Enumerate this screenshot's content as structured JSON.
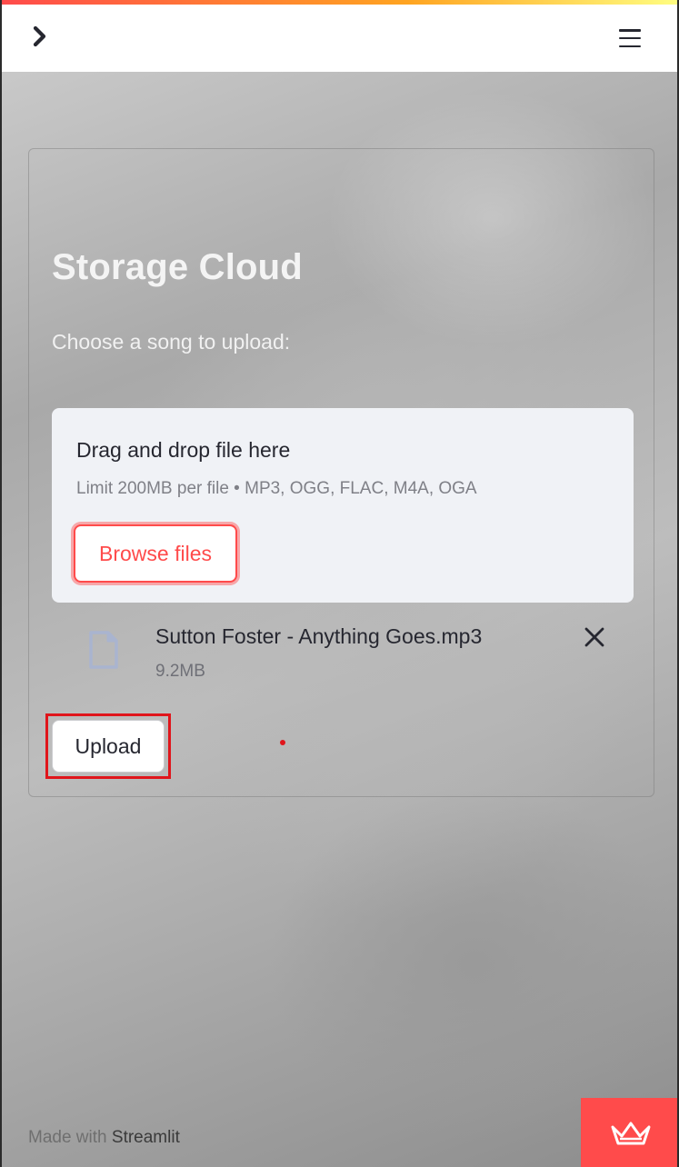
{
  "header": {
    "expand_icon": "chevron-right-icon",
    "menu_icon": "hamburger-menu-icon"
  },
  "main": {
    "title": "Storage Cloud",
    "uploader_label": "Choose a song to upload:",
    "dropzone": {
      "instruction": "Drag and drop file here",
      "limit_text": "Limit 200MB per file • MP3, OGG, FLAC, M4A, OGA",
      "browse_label": "Browse files"
    },
    "uploaded_file": {
      "icon": "file-icon",
      "name": "Sutton Foster - Anything Goes.mp3",
      "size": "9.2MB",
      "remove_icon": "close-icon"
    },
    "upload_label": "Upload"
  },
  "footer": {
    "made_with": "Made with",
    "brand": "Streamlit"
  },
  "colors": {
    "accent": "#ff4b4b",
    "highlight": "#e0151b",
    "dropzone_bg": "#f0f2f6"
  }
}
